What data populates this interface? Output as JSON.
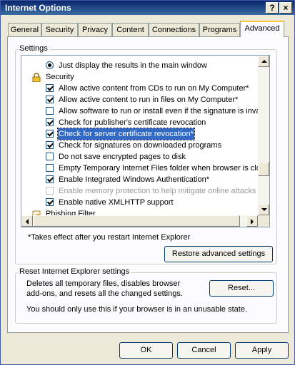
{
  "window": {
    "title": "Internet Options",
    "help_label": "?",
    "close_label": "×"
  },
  "tabs": [
    {
      "label": "General"
    },
    {
      "label": "Security"
    },
    {
      "label": "Privacy"
    },
    {
      "label": "Content"
    },
    {
      "label": "Connections"
    },
    {
      "label": "Programs"
    },
    {
      "label": "Advanced",
      "active": true
    }
  ],
  "settings": {
    "group_label": "Settings",
    "rows": [
      {
        "type": "radio",
        "label": "Just display the results in the main window"
      },
      {
        "type": "category",
        "label": "Security",
        "icon": "lock-icon"
      },
      {
        "type": "check",
        "checked": true,
        "label": "Allow active content from CDs to run on My Computer*"
      },
      {
        "type": "check",
        "checked": true,
        "label": "Allow active content to run in files on My Computer*"
      },
      {
        "type": "check",
        "checked": false,
        "label": "Allow software to run or install even if the signature is inva"
      },
      {
        "type": "check",
        "checked": true,
        "label": "Check for publisher's certificate revocation"
      },
      {
        "type": "check",
        "checked": true,
        "selected": true,
        "label": "Check for server certificate revocation*"
      },
      {
        "type": "check",
        "checked": true,
        "label": "Check for signatures on downloaded programs"
      },
      {
        "type": "check",
        "checked": false,
        "label": "Do not save encrypted pages to disk"
      },
      {
        "type": "check",
        "checked": false,
        "label": "Empty Temporary Internet Files folder when browser is clo"
      },
      {
        "type": "check",
        "checked": true,
        "label": "Enable Integrated Windows Authentication*"
      },
      {
        "type": "check",
        "checked": false,
        "disabled": true,
        "label": "Enable memory protection to help mitigate online attacks"
      },
      {
        "type": "check",
        "checked": true,
        "label": "Enable native XMLHTTP support"
      },
      {
        "type": "category",
        "label": "Phishing Filter",
        "icon": "phishing-filter-icon"
      }
    ],
    "restart_note": "*Takes effect after you restart Internet Explorer",
    "restore_label": "Restore advanced settings"
  },
  "reset": {
    "group_label": "Reset Internet Explorer settings",
    "desc_line1": "Deletes all temporary files, disables browser",
    "desc_line2": "add-ons, and resets all the changed settings.",
    "button_label": "Reset...",
    "warning": "You should only use this if your browser is in an unusable state."
  },
  "footer": {
    "ok_label": "OK",
    "cancel_label": "Cancel",
    "apply_label": "Apply"
  }
}
